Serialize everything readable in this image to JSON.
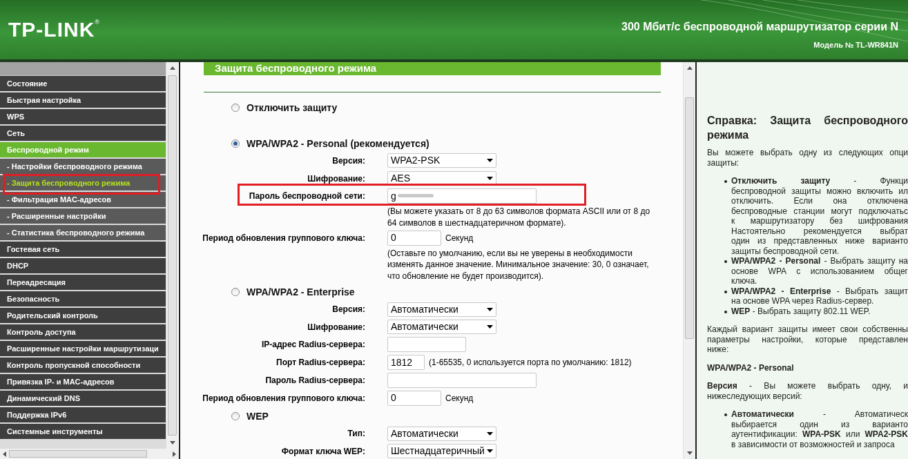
{
  "header": {
    "logo": "TP-LINK",
    "logo_mark": "®",
    "product": "300 Мбит/с беспроводной маршрутизатор серии N",
    "model": "Модель № TL-WR841N"
  },
  "sidebar": {
    "items": [
      {
        "label": "Состояние",
        "selected": false
      },
      {
        "label": "Быстрая настройка",
        "selected": false
      },
      {
        "label": "WPS",
        "selected": false
      },
      {
        "label": "Сеть",
        "selected": false
      },
      {
        "label": "Беспроводной режим",
        "selected": true,
        "children": [
          {
            "label": "- Настройки беспроводного режима",
            "selected": false
          },
          {
            "label": "- Защита беспроводного режима",
            "selected": true
          },
          {
            "label": "- Фильтрация MAC-адресов",
            "selected": false
          },
          {
            "label": "- Расширенные настройки",
            "selected": false
          },
          {
            "label": "- Статистика беспроводного режима",
            "selected": false
          }
        ]
      },
      {
        "label": "Гостевая сеть",
        "selected": false
      },
      {
        "label": "DHCP",
        "selected": false
      },
      {
        "label": "Переадресация",
        "selected": false
      },
      {
        "label": "Безопасность",
        "selected": false
      },
      {
        "label": "Родительский контроль",
        "selected": false
      },
      {
        "label": "Контроль доступа",
        "selected": false
      },
      {
        "label": "Расширенные настройки маршрутизаци",
        "selected": false
      },
      {
        "label": "Контроль пропускной способности",
        "selected": false
      },
      {
        "label": "Привязка IP- и MAC-адресов",
        "selected": false
      },
      {
        "label": "Динамический DNS",
        "selected": false
      },
      {
        "label": "Поддержка IPv6",
        "selected": false
      },
      {
        "label": "Системные инструменты",
        "selected": false
      }
    ]
  },
  "content": {
    "title": "Защита беспроводного режима",
    "sections": [
      {
        "label": "Отключить защиту",
        "selected": false
      },
      {
        "label": "WPA/WPA2 - Personal (рекомендуется)",
        "selected": true,
        "rows": [
          {
            "kind": "select",
            "label": "Версия:",
            "value": "WPA2-PSK"
          },
          {
            "kind": "select",
            "label": "Шифрование:",
            "value": "AES"
          },
          {
            "kind": "password",
            "label": "Пароль беспроводной сети:",
            "value": "g",
            "note": [
              "(Вы можете указать от 8 до 63 символов формата ASCII или от 8 до",
              "64 символов в шестнадцатеричном формате)."
            ]
          },
          {
            "kind": "short",
            "label": "Период обновления группового ключа:",
            "value": "0",
            "suffix": "Секунд",
            "note": [
              "(Оставьте по умолчанию, если вы не уверены в необходимости",
              "изменять данное значение. Минимальное значение: 30, 0 означает,",
              "что обновление не будет производится)."
            ]
          }
        ]
      },
      {
        "label": "WPA/WPA2 - Enterprise",
        "selected": false,
        "rows": [
          {
            "kind": "select",
            "label": "Версия:",
            "value": "Автоматически"
          },
          {
            "kind": "select",
            "label": "Шифрование:",
            "value": "Автоматически"
          },
          {
            "kind": "medium",
            "label": "IP-адрес Radius-сервера:"
          },
          {
            "kind": "tiny",
            "label": "Порт Radius-сервера:",
            "value": "1812",
            "suffix": "(1-65535, 0 используется порта по умолчанию: 1812)"
          },
          {
            "kind": "long",
            "label": "Пароль Radius-сервера:"
          },
          {
            "kind": "short",
            "label": "Период обновления группового ключа:",
            "value": "0",
            "suffix": "Секунд"
          }
        ]
      },
      {
        "label": "WEP",
        "selected": false,
        "rows": [
          {
            "kind": "select",
            "label": "Тип:",
            "value": "Автоматически"
          },
          {
            "kind": "select",
            "label": "Формат ключа WEP:",
            "value": "Шестнадцатеричный"
          }
        ]
      }
    ]
  },
  "help": {
    "title_lines": [
      "Справка: Защита беспроводного",
      "режима"
    ],
    "blocks": [
      {
        "kind": "para",
        "lines": [
          "Вы можете выбрать одну из следующих опци",
          "защиты:"
        ]
      },
      {
        "kind": "bullets",
        "items": [
          {
            "lines": [
              "**Отключить защиту** - Функци",
              "беспроводной защиты можно включить ил",
              "отключить. Если она отключена",
              "беспроводные станции могут подключатьс",
              "к маршрутизатору без шифрования",
              "Настоятельно рекомендуется выбрат",
              "один из представленных ниже варианто",
              "защиты беспроводной сети."
            ]
          },
          {
            "lines": [
              "**WPA/WPA2 - Personal** - Выбрать защиту на",
              "основе WPA с использованием общег",
              "ключа."
            ]
          },
          {
            "lines": [
              "**WPA/WPA2 - Enterprise** - Выбрать защит",
              "на основе WPA через Radius-сервер."
            ]
          },
          {
            "lines": [
              "**WEP** - Выбрать защиту 802.11 WEP."
            ]
          }
        ]
      },
      {
        "kind": "para",
        "lines": [
          "Каждый вариант защиты имеет свои собственны",
          "параметры настройки, которые представлен",
          "ниже:"
        ]
      },
      {
        "kind": "heading",
        "lines": [
          "WPA/WPA2 - Personal"
        ]
      },
      {
        "kind": "para",
        "lines": [
          "**Версия** - Вы можете выбрать одну, и",
          "нижеследующих версий:"
        ]
      },
      {
        "kind": "bullets",
        "items": [
          {
            "lines": [
              "**Автоматически** - Автоматическ",
              "выбирается один из варианто",
              "аутентификации: **WPA-PSK** или **WPA2-PSK**",
              "в зависимости от возможностей и запроса"
            ]
          }
        ]
      }
    ]
  }
}
